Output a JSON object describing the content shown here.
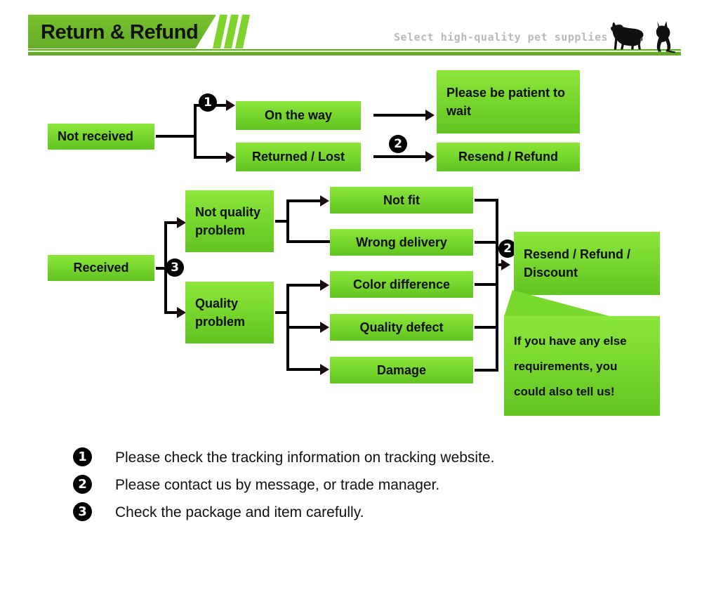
{
  "header": {
    "title": "Return & Refund",
    "tagline": "Select high-quality pet supplies",
    "accent_green": "#6cb52a",
    "stripe_green": "#7fd32f",
    "rule_green": "#65ab24",
    "tagline_color": "#b9b9b9",
    "icons": [
      "dog-silhouette",
      "cat-silhouette"
    ]
  },
  "flow": {
    "box_gradient_top": "#8ce63b",
    "box_gradient_bottom": "#63c422",
    "section_not_received": {
      "source": "Not received",
      "marker": "1",
      "branches": [
        "On the way",
        "Returned / Lost"
      ],
      "outcomes": [
        "Please be patient to wait",
        "Resend / Refund"
      ],
      "outcome_marker": "2"
    },
    "section_received": {
      "source": "Received",
      "marker": "3",
      "categories": [
        "Not quality problem",
        "Quality problem"
      ],
      "not_quality_reasons": [
        "Not fit",
        "Wrong delivery"
      ],
      "quality_reasons": [
        "Color difference",
        "Quality defect",
        "Damage"
      ],
      "outcome": "Resend / Refund / Discount",
      "outcome_marker": "2",
      "callout": "If you have any else requirements, you could also tell us!"
    }
  },
  "notes": [
    {
      "num": "1",
      "text": "Please check the tracking information on tracking website."
    },
    {
      "num": "2",
      "text": "Please contact us by message, or trade manager."
    },
    {
      "num": "3",
      "text": "Check the package and item carefully."
    }
  ]
}
